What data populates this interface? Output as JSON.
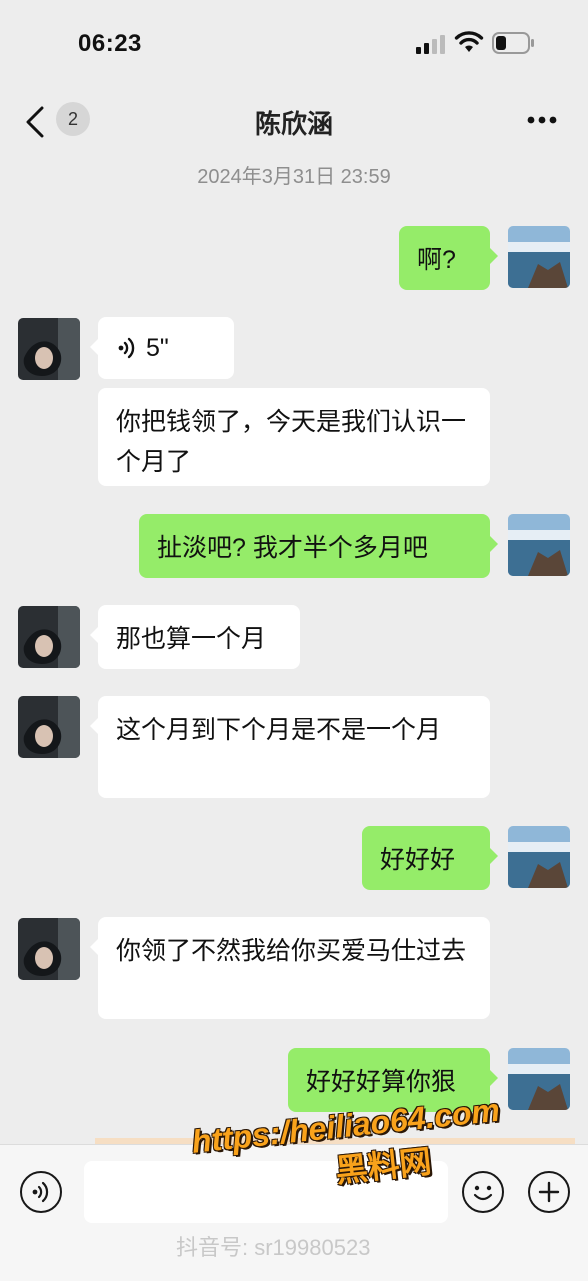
{
  "status_bar": {
    "time": "06:23",
    "icons": [
      "signal-icon",
      "wifi-icon",
      "battery-icon"
    ]
  },
  "nav": {
    "back_icon": "chevron-left-icon",
    "unread_count": "2",
    "title": "陈欣涵",
    "more_icon": "more-dots-icon"
  },
  "chat": {
    "timestamp": "2024年3月31日  23:59",
    "messages": [
      {
        "side": "out",
        "type": "text",
        "text": "啊?"
      },
      {
        "side": "in",
        "type": "voice",
        "duration": "5\""
      },
      {
        "side": "in",
        "type": "text",
        "text": "你把钱领了，今天是我们认识一个月了"
      },
      {
        "side": "out",
        "type": "text",
        "text": "扯淡吧?  我才半个多月吧"
      },
      {
        "side": "in",
        "type": "text",
        "text": "那也算一个月"
      },
      {
        "side": "in",
        "type": "text",
        "text": "这个月到下个月是不是一个月"
      },
      {
        "side": "out",
        "type": "text",
        "text": "好好好"
      },
      {
        "side": "in",
        "type": "text",
        "text": "你领了不然我给你买爱马仕过去"
      },
      {
        "side": "out",
        "type": "text",
        "text": "好好好算你狠"
      }
    ]
  },
  "input_bar": {
    "voice_icon": "voice-input-icon",
    "emoji_icon": "emoji-icon",
    "plus_icon": "plus-icon"
  },
  "watermark": {
    "url": "https:/heiliao64.com",
    "name": "黑料网",
    "tiktok": "抖音号: sr19980523"
  },
  "colors": {
    "background": "#ededed",
    "outgoing_bubble": "#95ec69",
    "incoming_bubble": "#ffffff",
    "watermark": "#f9a21b"
  }
}
